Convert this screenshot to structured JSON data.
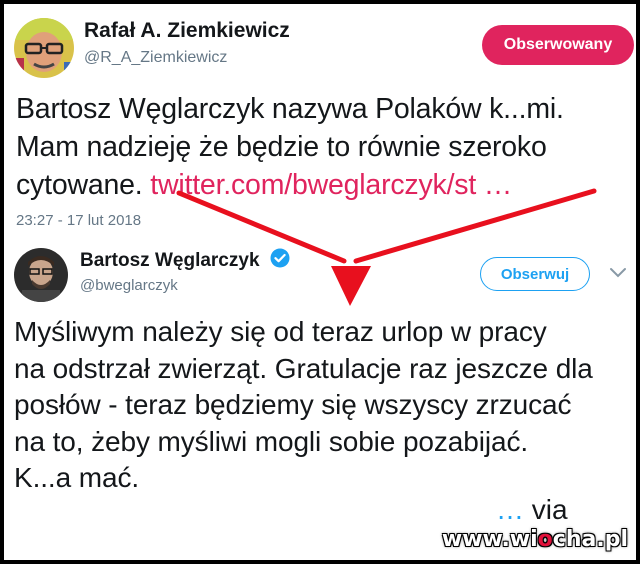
{
  "retweeter": {
    "name": "Rafał A. Ziemkiewicz",
    "handle": "@R_A_Ziemkiewicz",
    "follow_label": "Obserwowany",
    "tweet_text": "Bartosz Węglarczyk nazywa Polaków k...mi. Mam nadzieję że będzie to równie szeroko cytowane.",
    "tweet_link": "twitter.com/bweglarczyk/st …",
    "timestamp": "23:27 - 17 lut 2018"
  },
  "quoted": {
    "name": "Bartosz Węglarczyk",
    "handle": "@bweglarczyk",
    "follow_label": "Obserwuj",
    "verified": true,
    "tweet_text_lines": [
      "Myśliwym należy się od teraz urlop w pracy",
      "na odstrzał zwierząt. Gratulacje raz jeszcze dla",
      "posłów - teraz będziemy się wszyscy zrzucać",
      "na to, żeby myśliwi mogli sobie pozabijać.",
      "K...a mać."
    ],
    "via_dots": "…",
    "via_label": "via"
  },
  "watermark": {
    "prefix": "www.wi",
    "o": "o",
    "suffix": "cha.pl"
  },
  "colors": {
    "follow_red": "#e0245e",
    "link_red": "#e0245e",
    "arrow_red": "#e8101e",
    "twitter_blue": "#1da1f2"
  }
}
